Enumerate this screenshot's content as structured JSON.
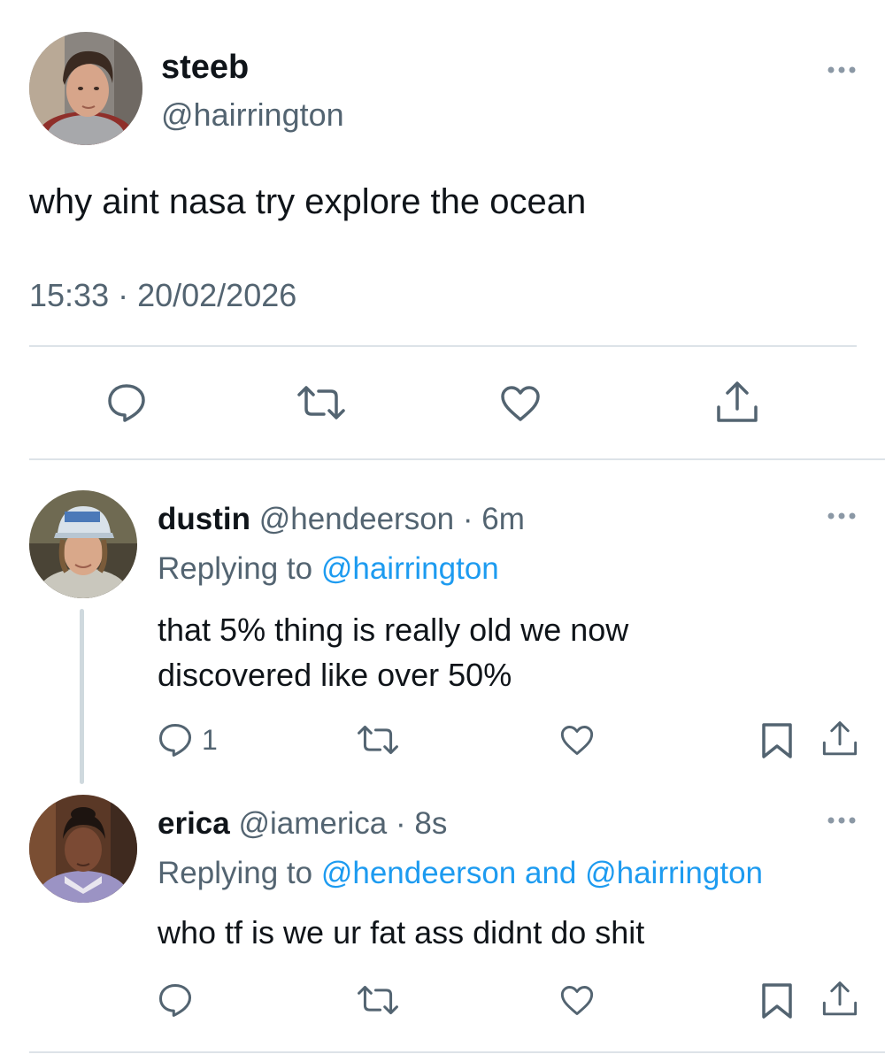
{
  "main_tweet": {
    "display_name": "steeb",
    "handle": "@hairrington",
    "text": "why aint nasa try explore the ocean",
    "timestamp": "15:33 · 20/02/2026",
    "actions": [
      "reply-icon",
      "retweet-icon",
      "like-icon",
      "share-icon"
    ]
  },
  "replies": [
    {
      "display_name": "dustin",
      "handle": "@hendeerson",
      "age": "· 6m",
      "replying_prefix": "Replying to",
      "replying_to": "@hairrington",
      "text_lines": [
        "that 5% thing is really old we now",
        "discovered like over 50%"
      ],
      "reply_count": "1"
    },
    {
      "display_name": "erica",
      "handle": "@iamerica",
      "age": "· 8s",
      "replying_prefix": "Replying to",
      "replying_to": "@hendeerson and @hairrington",
      "text_lines": [
        "who tf is we ur fat ass didnt do shit"
      ],
      "reply_count": ""
    }
  ],
  "colors": {
    "text": "#0f1419",
    "muted": "#536471",
    "link": "#1d9bf0",
    "icon": "#536471",
    "divider": "#dde3e8"
  }
}
